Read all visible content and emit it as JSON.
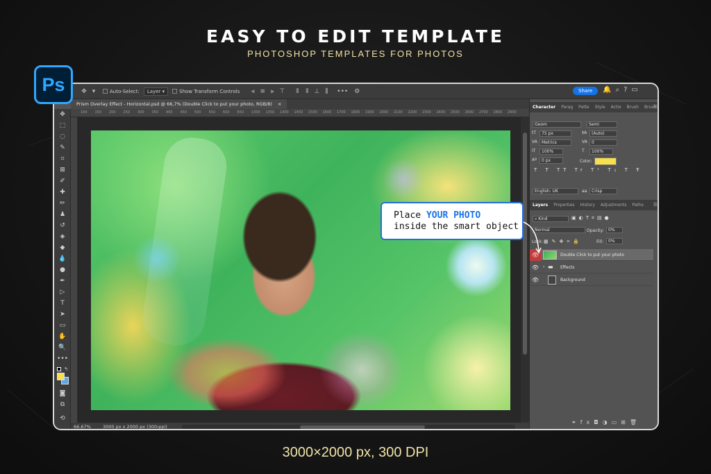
{
  "hero": {
    "title": "EASY TO EDIT TEMPLATE",
    "subtitle": "PHOTOSHOP TEMPLATES FOR PHOTOS",
    "spec": "3000×2000 px, 300 DPI"
  },
  "app_logo": "Ps",
  "options_bar": {
    "auto_select_label": "Auto-Select:",
    "auto_select_value": "Layer",
    "show_transform_label": "Show Transform Controls",
    "more_label": "•••",
    "share_label": "Share"
  },
  "document": {
    "tab_title": "Prism Overlay Effect - Horizontal.psd @ 66,7% (Double Click to put your photo, RGB/8)",
    "close_glyph": "×",
    "zoom": "66.67%",
    "doc_info": "3000 px x 2000 px (300 ppi)",
    "ruler_ticks": [
      "100",
      "150",
      "200",
      "250",
      "300",
      "350",
      "400",
      "450",
      "500",
      "550",
      "600",
      "650",
      "1300",
      "1350",
      "1400",
      "1450",
      "1500",
      "1600",
      "1700",
      "1800",
      "1900",
      "2000",
      "2100",
      "2200",
      "2300",
      "2400",
      "2500",
      "2600",
      "2700",
      "2800",
      "2900"
    ]
  },
  "character_panel": {
    "tabs": [
      "Character",
      "Parag",
      "Patte",
      "Style",
      "Actio",
      "Brush",
      "Brush"
    ],
    "font_family": "Geom",
    "font_style": "Semi",
    "font_size": "75 px",
    "leading": "(Auto)",
    "kerning": "Metrics",
    "tracking": "0",
    "vertical_scale": "100%",
    "horizontal_scale": "100%",
    "baseline": "0 px",
    "color_label": "Color:",
    "color_value": "#f7df4d",
    "type_buttons": "T T TT Tr T¹ T₁ T Ŧ",
    "language": "English: UK",
    "antialias": "Crisp"
  },
  "layers_panel": {
    "tabs": [
      "Layers",
      "Properties",
      "History",
      "Adjustments",
      "Paths"
    ],
    "filter_kind": "Kind",
    "blend_mode": "Normal",
    "opacity_label": "Opacity:",
    "opacity_value": "0%",
    "lock_label": "Lock:",
    "fill_label": "Fill:",
    "fill_value": "0%",
    "layers": [
      {
        "name": "Double Click to put your photo",
        "selected": true
      },
      {
        "name": "Effects",
        "selected": false
      },
      {
        "name": "Background",
        "selected": false
      }
    ]
  },
  "callout": {
    "line1_prefix": "Place ",
    "line1_highlight": "YOUR PHOTO",
    "line2": "inside the smart object"
  }
}
